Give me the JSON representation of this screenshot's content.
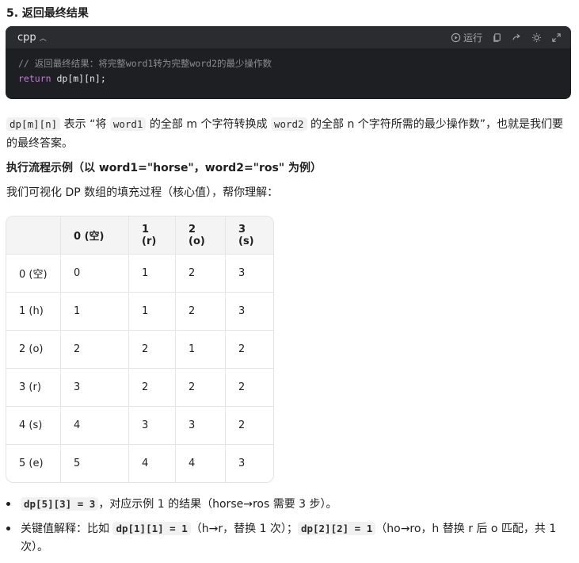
{
  "section_title": "5. 返回最终结果",
  "code": {
    "language": "cpp",
    "run_label": "运行",
    "comment_line": "// 返回最终结果：将完整word1转为完整word2的最少操作数",
    "keyword": "return",
    "expr": " dp[m][n];"
  },
  "explanation": {
    "code1": "dp[m][n]",
    "t1": " 表示 “将 ",
    "code2": "word1",
    "t2": " 的全部 m 个字符转换成 ",
    "code3": "word2",
    "t3": " 的全部 n 个字符所需的最少操作数”，也就是我们要的最终答案。"
  },
  "example_heading": "执行流程示例（以 word1=\"horse\"，word2=\"ros\" 为例）",
  "intro": "我们可视化 DP 数组的填充过程（核心值），帮你理解：",
  "table": {
    "headers": [
      "",
      "0 (空)",
      "1 (r)",
      "2 (o)",
      "3 (s)"
    ],
    "rows": [
      [
        "0 (空)",
        "0",
        "1",
        "2",
        "3"
      ],
      [
        "1 (h)",
        "1",
        "1",
        "2",
        "3"
      ],
      [
        "2 (o)",
        "2",
        "2",
        "1",
        "2"
      ],
      [
        "3 (r)",
        "3",
        "2",
        "2",
        "2"
      ],
      [
        "4 (s)",
        "4",
        "3",
        "3",
        "2"
      ],
      [
        "5 (e)",
        "5",
        "4",
        "4",
        "3"
      ]
    ]
  },
  "bullets": {
    "b1_code": "dp[5][3] = 3",
    "b1_text": "，对应示例 1 的结果（horse→ros 需要 3 步）。",
    "b2_t1": "关键值解释：比如 ",
    "b2_code1": "dp[1][1] = 1",
    "b2_t2": "（h→r，替换 1 次）；",
    "b2_code2": "dp[2][2] = 1",
    "b2_t3": "（ho→ro，h 替换 r 后 o 匹配，共 1 次）。"
  }
}
